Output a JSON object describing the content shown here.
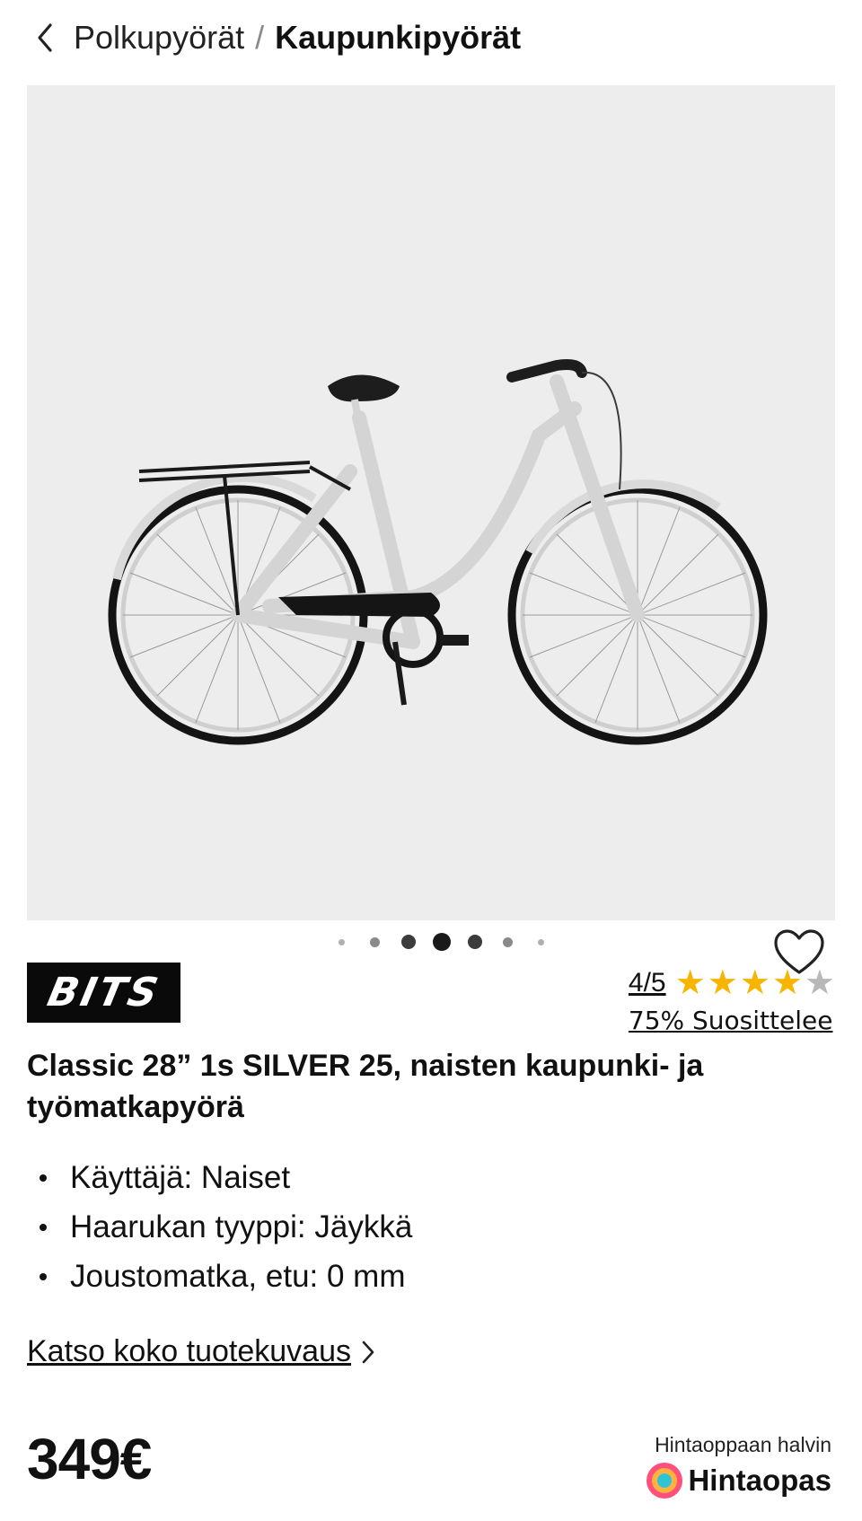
{
  "breadcrumb": {
    "parent": "Polkupyörät",
    "separator": "/",
    "current": "Kaupunkipyörät"
  },
  "gallery": {
    "dot_count": 7,
    "active_dot": 3,
    "favorite_icon": "heart-outline-icon",
    "background": "#eeedee"
  },
  "product": {
    "brand": "BITS",
    "rating_score": "4/5",
    "rating_value": 4,
    "rating_max": 5,
    "recommend": "75% Suosittelee",
    "title": "Classic 28” 1s SILVER 25, naisten kaupunki- ja työmatkapyörä",
    "specs": [
      "Käyttäjä: Naiset",
      "Haarukan tyyppi: Jäykkä",
      "Joustomatka, etu: 0 mm"
    ],
    "full_description_link": "Katso koko tuotekuvaus",
    "price": "349€"
  },
  "hintaopas": {
    "caption": "Hintaoppaan halvin",
    "logo_text": "Hintaopas"
  },
  "colors": {
    "star_filled": "#f7b500",
    "star_empty": "#b8b8b8",
    "text": "#111111"
  }
}
